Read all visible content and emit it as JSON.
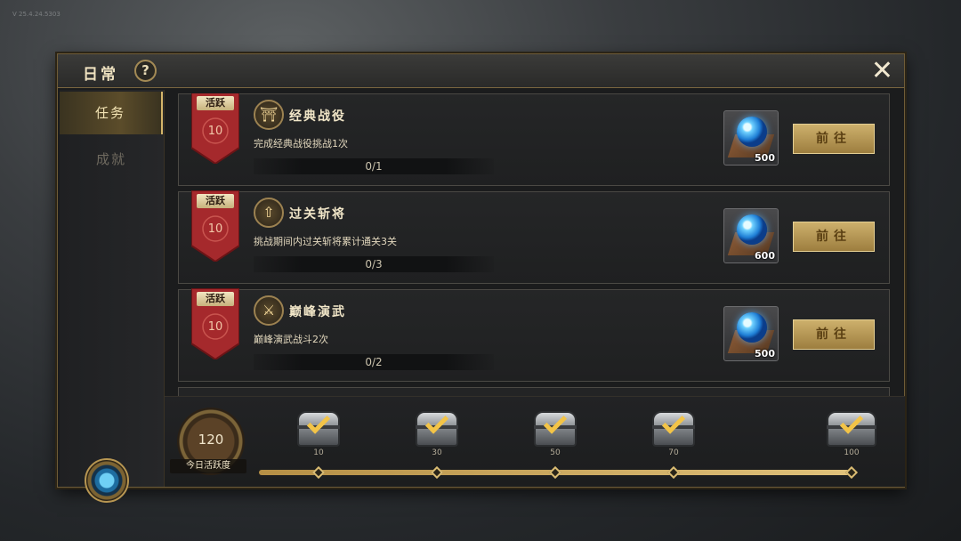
{
  "version": "V 25.4.24.5303",
  "header": {
    "title": "日常",
    "help": "?",
    "close": "✕"
  },
  "sidebar": {
    "tabs": [
      {
        "label": "任务",
        "active": true
      },
      {
        "label": "成就",
        "active": false
      }
    ]
  },
  "tasks": [
    {
      "badge": "活跃",
      "points": "10",
      "icon": "⛩",
      "name": "经典战役",
      "desc": "完成经典战役挑战1次",
      "progress": "0/1",
      "progress_value": 0,
      "reward_qty": "500",
      "button": "前往"
    },
    {
      "badge": "活跃",
      "points": "10",
      "icon": "⇧",
      "name": "过关斩将",
      "desc": "挑战期间内过关斩将累计通关3关",
      "progress": "0/3",
      "progress_value": 0,
      "reward_qty": "600",
      "button": "前往"
    },
    {
      "badge": "活跃",
      "points": "10",
      "icon": "⚔",
      "name": "巅峰演武",
      "desc": "巅峰演武战斗2次",
      "progress": "0/2",
      "progress_value": 0,
      "reward_qty": "500",
      "button": "前往"
    }
  ],
  "activity": {
    "value": "120",
    "label": "今日活跃度",
    "fill_fraction": 1.0
  },
  "chests": [
    {
      "threshold": "10"
    },
    {
      "threshold": "30"
    },
    {
      "threshold": "50"
    },
    {
      "threshold": "70"
    },
    {
      "threshold": "100"
    }
  ],
  "colors": {
    "accent": "#d9bb73",
    "button": "#b8974f",
    "banner": "#a5292c"
  }
}
